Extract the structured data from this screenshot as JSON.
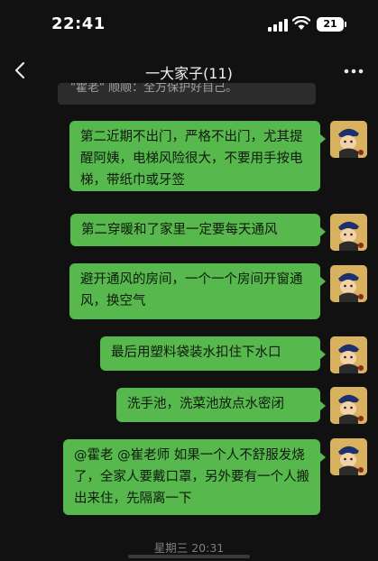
{
  "status_bar": {
    "time": "22:41",
    "battery": "21"
  },
  "nav": {
    "title": "一大家子(11)"
  },
  "chat": {
    "quoted_preview": "\"霍老\" 顺顺：全方保护好自己。",
    "messages": [
      {
        "text": "第二近期不出门，严格不出门，尤其提醒阿姨，电梯风险很大，不要用手按电梯，带纸巾或牙签"
      },
      {
        "text": "第二穿暖和了家里一定要每天通风"
      },
      {
        "text": "避开通风的房间，一个一个房间开窗通风，换空气"
      },
      {
        "text": "最后用塑料袋装水扣住下水口"
      },
      {
        "text": "洗手池，洗菜池放点水密闭"
      },
      {
        "text": "@霍老 @崔老师 如果一个人不舒服发烧了，全家人要戴口罩，另外要有一个人搬出来住，先隔离一下"
      }
    ],
    "timestamp": "星期三 20:31"
  },
  "colors": {
    "bubble": "#56b84d",
    "background": "#111111",
    "avatar": "#d9b25f"
  }
}
